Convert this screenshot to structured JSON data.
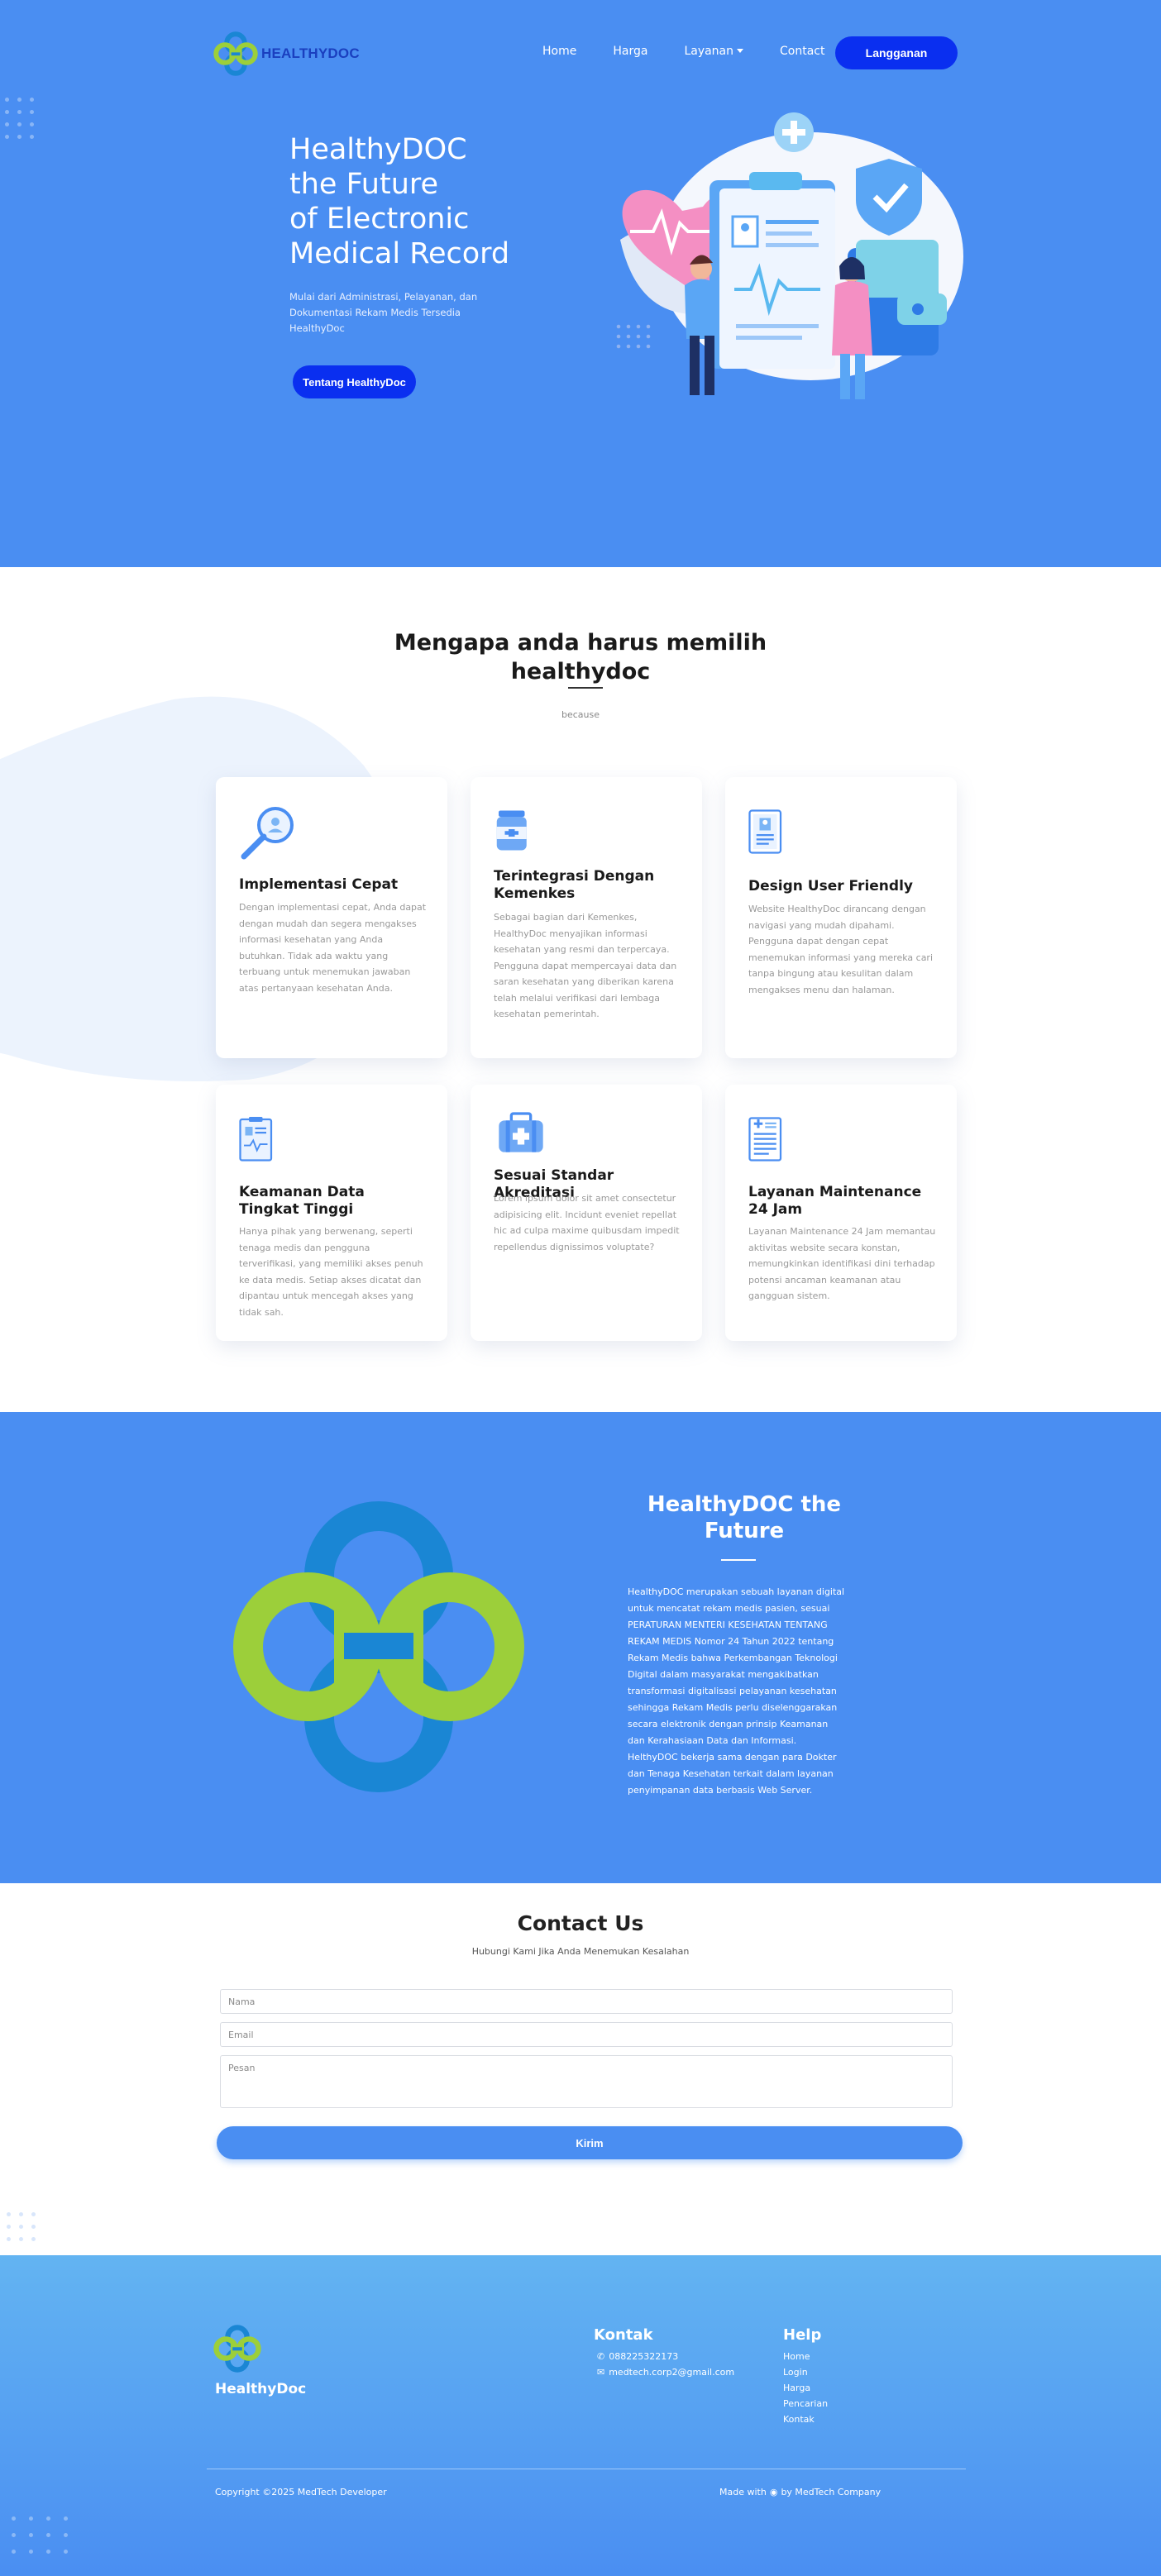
{
  "nav": {
    "brand": "HEALTHYDOC",
    "links": [
      "Home",
      "Harga",
      "Layanan",
      "Contact"
    ],
    "cta": "Langganan"
  },
  "hero": {
    "title_lines": [
      "HealthyDOC",
      "the Future",
      "of Electronic",
      "Medical Record"
    ],
    "subtitle": "Mulai dari Administrasi, Pelayanan, dan Dokumentasi Rekam Medis Tersedia HealthyDoc",
    "button": "Tentang HealthyDoc"
  },
  "why": {
    "title": "Mengapa anda harus memilih healthydoc",
    "subtitle": "because",
    "cards": [
      {
        "icon": "magnifier-icon",
        "title": "Implementasi Cepat",
        "text": "Dengan implementasi cepat, Anda dapat dengan mudah dan segera mengakses informasi kesehatan yang Anda butuhkan. Tidak ada waktu yang terbuang untuk menemukan jawaban atas pertanyaan kesehatan Anda."
      },
      {
        "icon": "medicine-bottle-icon",
        "title": "Terintegrasi Dengan Kemenkes",
        "text": "Sebagai bagian dari Kemenkes, HealthyDoc menyajikan informasi kesehatan yang resmi dan terpercaya. Pengguna dapat mempercayai data dan saran kesehatan yang diberikan karena telah melalui verifikasi dari lembaga kesehatan pemerintah."
      },
      {
        "icon": "tablet-profile-icon",
        "title": "Design User Friendly",
        "text": "Website HealthyDoc dirancang dengan navigasi yang mudah dipahami. Pengguna dapat dengan cepat menemukan informasi yang mereka cari tanpa bingung atau kesulitan dalam mengakses menu dan halaman."
      },
      {
        "icon": "clipboard-report-icon",
        "title": "Keamanan Data Tingkat Tinggi",
        "text": "Hanya pihak yang berwenang, seperti tenaga medis dan pengguna terverifikasi, yang memiliki akses penuh ke data medis. Setiap akses dicatat dan dipantau untuk mencegah akses yang tidak sah."
      },
      {
        "icon": "medical-kit-icon",
        "title": "Sesuai Standar Akreditasi",
        "text": "Lorem ipsum dolor sit amet consectetur adipisicing elit. Incidunt eveniet repellat hic ad culpa maxime quibusdam impedit repellendus dignissimos voluptate?"
      },
      {
        "icon": "medical-document-icon",
        "title": "Layanan Maintenance 24 Jam",
        "text": "Layanan Maintenance 24 Jam memantau aktivitas website secara konstan, memungkinkan identifikasi dini terhadap potensi ancaman keamanan atau gangguan sistem."
      }
    ]
  },
  "future": {
    "title": "HealthyDOC the Future",
    "text": "HealthyDOC merupakan sebuah layanan digital untuk mencatat rekam medis pasien, sesuai PERATURAN MENTERI KESEHATAN TENTANG REKAM MEDIS Nomor 24 Tahun 2022 tentang Rekam Medis bahwa Perkembangan Teknologi Digital dalam masyarakat mengakibatkan transformasi digitalisasi pelayanan kesehatan sehingga Rekam Medis perlu diselenggarakan secara elektronik dengan prinsip Keamanan dan Kerahasiaan Data dan Informasi. HelthyDOC bekerja sama dengan para Dokter dan Tenaga Kesehatan terkait dalam layanan penyimpanan data berbasis Web Server."
  },
  "contact": {
    "title": "Contact Us",
    "subtitle": "Hubungi Kami Jika Anda Menemukan Kesalahan",
    "name_placeholder": "Nama",
    "email_placeholder": "Email",
    "message_placeholder": "Pesan",
    "submit": "Kirim"
  },
  "footer": {
    "brand": "HealthyDoc",
    "kontak_title": "Kontak",
    "phone": "088225322173",
    "email": "medtech.corp2@gmail.com",
    "help_title": "Help",
    "help_links": [
      "Home",
      "Login",
      "Harga",
      "Pencarian",
      "Kontak"
    ],
    "copyright": "Copyright ©2025 MedTech Developer",
    "made_prefix": "Made with",
    "made_suffix": "by MedTech Company"
  },
  "colors": {
    "primary": "#4a8ef2",
    "button_dark": "#0a2ff0",
    "logo_green": "#9ccf3a",
    "logo_blue": "#1a86d4"
  }
}
